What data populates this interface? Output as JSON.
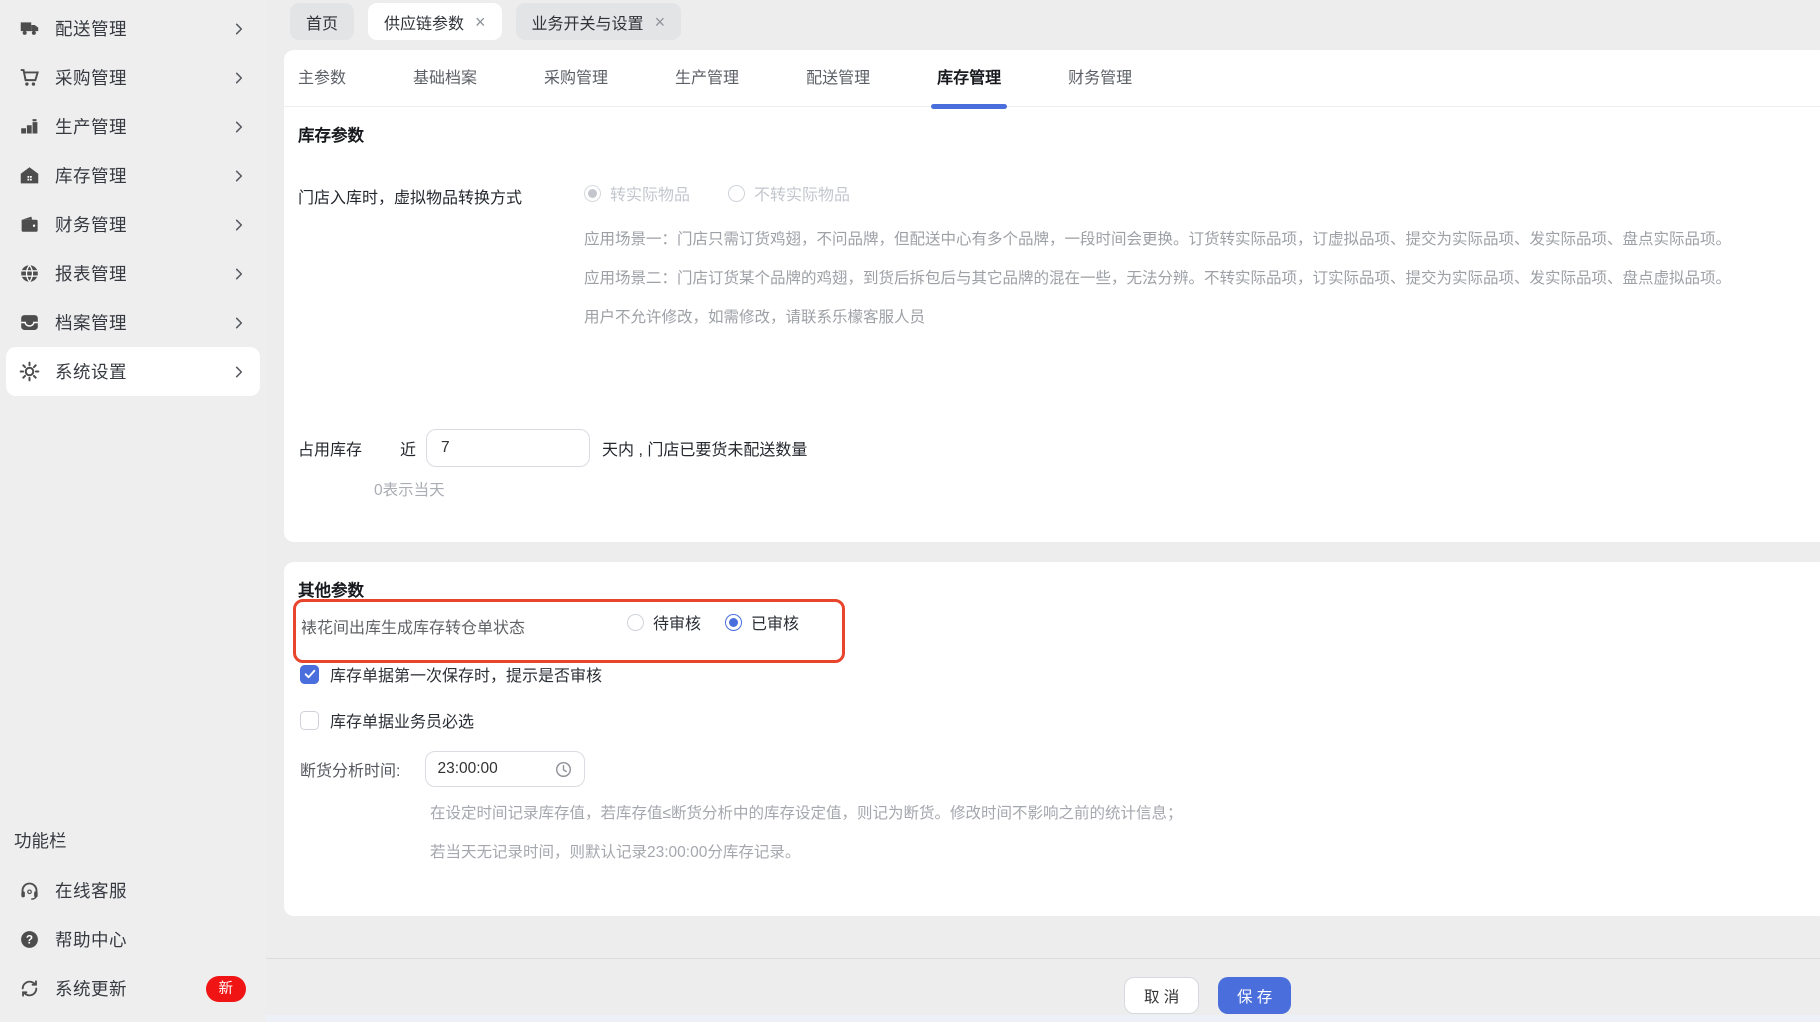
{
  "colors": {
    "accent": "#4a6edb",
    "highlight_red": "#e8452c",
    "badge_red": "#f01414"
  },
  "sidebar": {
    "items": [
      {
        "label": "配送管理",
        "icon": "truck-icon"
      },
      {
        "label": "采购管理",
        "icon": "cart-icon"
      },
      {
        "label": "生产管理",
        "icon": "production-icon"
      },
      {
        "label": "库存管理",
        "icon": "warehouse-icon"
      },
      {
        "label": "财务管理",
        "icon": "wallet-icon"
      },
      {
        "label": "报表管理",
        "icon": "globe-icon"
      },
      {
        "label": "档案管理",
        "icon": "archive-icon"
      },
      {
        "label": "系统设置",
        "icon": "gear-icon",
        "active": true
      }
    ],
    "section_label": "功能栏",
    "footer_items": [
      {
        "label": "在线客服",
        "icon": "headset-icon"
      },
      {
        "label": "帮助中心",
        "icon": "help-icon"
      },
      {
        "label": "系统更新",
        "icon": "refresh-icon",
        "badge": "新"
      }
    ]
  },
  "tabbar": {
    "tabs": [
      {
        "label": "首页",
        "active": false
      },
      {
        "label": "供应链参数",
        "close": "×",
        "active": true
      },
      {
        "label": "业务开关与设置",
        "close": "×",
        "active": false
      }
    ]
  },
  "param_tabs": {
    "items": [
      {
        "label": "主参数"
      },
      {
        "label": "基础档案"
      },
      {
        "label": "采购管理"
      },
      {
        "label": "生产管理"
      },
      {
        "label": "配送管理"
      },
      {
        "label": "库存管理",
        "active": true
      },
      {
        "label": "财务管理"
      }
    ]
  },
  "inventory": {
    "title": "库存参数",
    "virtual_label": "门店入库时，虚拟物品转换方式",
    "virtual_options": [
      {
        "label": "转实际物品",
        "selected": true,
        "disabled": true
      },
      {
        "label": "不转实际物品",
        "selected": false,
        "disabled": true
      }
    ],
    "scenario1": "应用场景一：门店只需订货鸡翅，不问品牌，但配送中心有多个品牌，一段时间会更换。订货转实际品项，订虚拟品项、提交为实际品项、发实际品项、盘点实际品项。",
    "scenario2": "应用场景二：门店订货某个品牌的鸡翅，到货后拆包后与其它品牌的混在一些，无法分辨。不转实际品项，订实际品项、提交为实际品项、发实际品项、盘点虚拟品项。",
    "note": "用户不允许修改，如需修改，请联系乐檬客服人员",
    "occupy": {
      "label": "占用库存",
      "prefix": "近",
      "value": "7",
      "suffix": "天内 , 门店已要货未配送数量",
      "helper": "0表示当天"
    }
  },
  "other": {
    "title": "其他参数",
    "transfer_label": "裱花间出库生成库存转仓单状态",
    "transfer_options": [
      {
        "label": "待审核",
        "selected": false
      },
      {
        "label": "已审核",
        "selected": true
      }
    ],
    "checkbox1": {
      "label": "库存单据第一次保存时，提示是否审核",
      "checked": true
    },
    "checkbox2": {
      "label": "库存单据业务员必选",
      "checked": false
    },
    "stockout_label": "断货分析时间:",
    "stockout_value": "23:00:00",
    "stockout_helper1": "在设定时间记录库存值，若库存值≤断货分析中的库存设定值，则记为断货。修改时间不影响之前的统计信息；",
    "stockout_helper2": "若当天无记录时间，则默认记录23:00:00分库存记录。"
  },
  "footer": {
    "cancel": "取 消",
    "save": "保 存"
  }
}
